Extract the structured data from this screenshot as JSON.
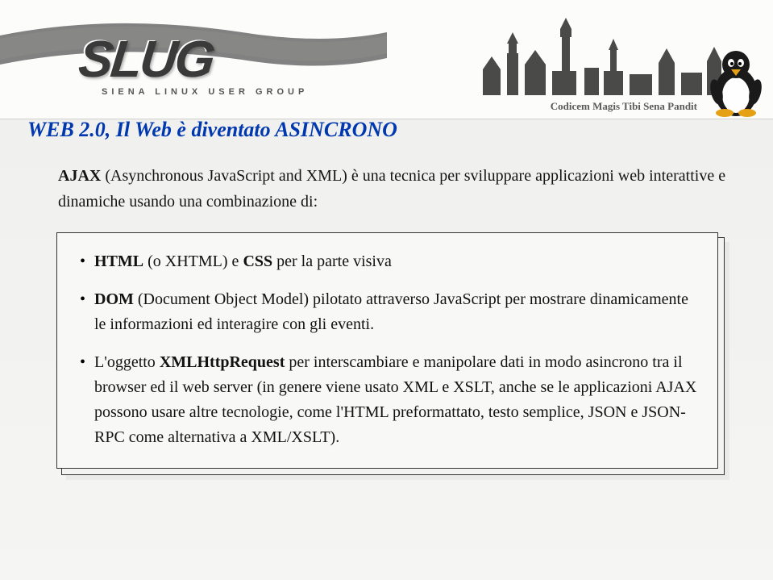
{
  "banner": {
    "logo_text": "SLUG",
    "logo_sub": "SIENA LINUX USER GROUP",
    "latin_motto": "Codicem Magis Tibi Sena Pandit"
  },
  "slide": {
    "title": "WEB 2.0, Il Web è diventato ASINCRONO",
    "intro_part1": "AJAX",
    "intro_part2": " (Asynchronous JavaScript and XML) è una tecnica per sviluppare applicazioni web interattive e dinamiche usando una combinazione di:",
    "bullets": [
      {
        "b1": "HTML",
        "t1": " (o XHTML) e ",
        "b2": "CSS",
        "t2": " per la parte visiva"
      },
      {
        "b1": "DOM",
        "t1": " (Document Object Model) pilotato attraverso JavaScript per mostrare dinamicamente le informazioni ed interagire con gli eventi."
      },
      {
        "t0": "L'oggetto ",
        "b1": "XMLHttpRequest",
        "t1": " per interscambiare e manipolare dati in modo asincrono tra il browser ed il web server (in genere viene usato XML e XSLT, anche se le applicazioni AJAX possono usare altre tecnologie, come l'HTML preformattato, testo semplice, JSON e JSON-RPC come alternativa a XML/XSLT)."
      }
    ]
  }
}
